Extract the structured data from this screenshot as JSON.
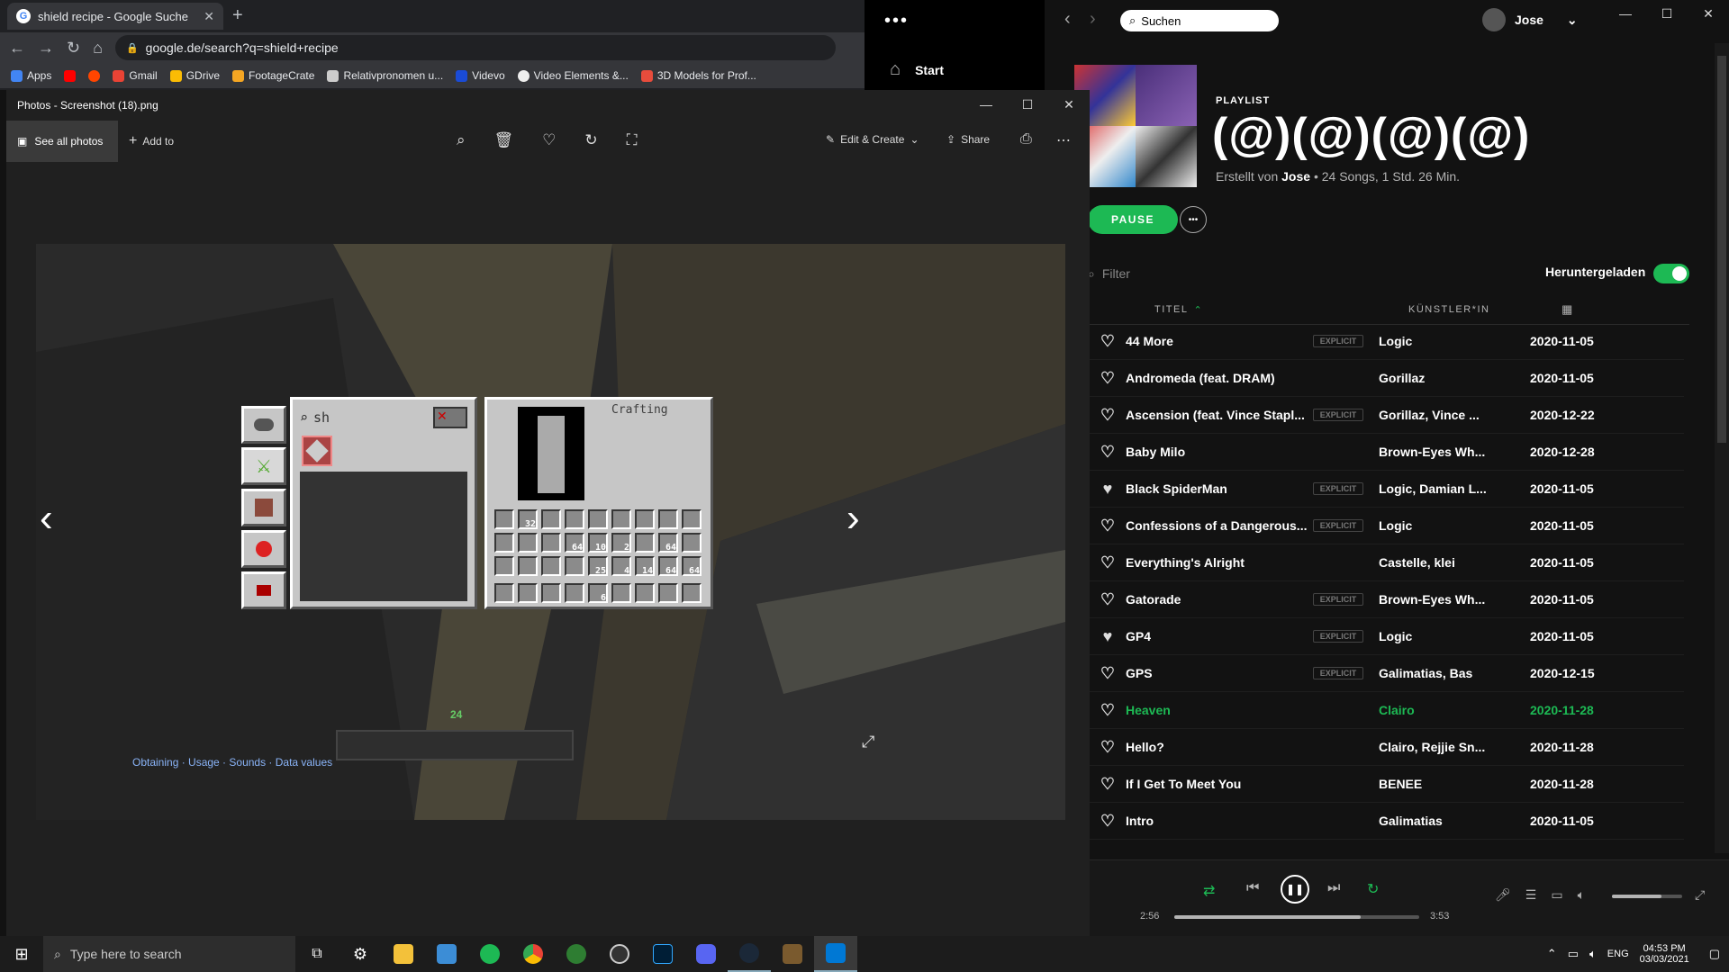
{
  "chrome": {
    "tab_title": "shield recipe - Google Suche",
    "url": "google.de/search?q=shield+recipe",
    "bookmarks": [
      "Apps",
      "",
      "",
      "Gmail",
      "GDrive",
      "FootageCrate",
      "Relativpronomen u...",
      "Videvo",
      "Video Elements &...",
      "3D Models for Prof..."
    ]
  },
  "photos": {
    "title": "Photos - Screenshot (18).png",
    "see_all": "See all photos",
    "add_to": "Add to",
    "edit_create": "Edit & Create",
    "share": "Share",
    "bottom_links": "Obtaining · Usage · Sounds · Data values"
  },
  "minecraft": {
    "search_text": "sh",
    "crafting_label": "Crafting",
    "stack_counts": [
      "32",
      "64",
      "10",
      "2",
      "64",
      "25",
      "4",
      "14",
      "64",
      "64",
      "6"
    ],
    "xp_level": "24"
  },
  "spotify": {
    "search_placeholder": "Suchen",
    "user": "Jose",
    "sidebar_start": "Start",
    "type_label": "PLAYLIST",
    "playlist_title": "(@)(@)(@)(@)",
    "created_by_prefix": "Erstellt von",
    "owner": "Jose",
    "meta": " • 24 Songs, 1 Std. 26 Min.",
    "pause": "PAUSE",
    "filter_placeholder": "Filter",
    "downloaded_label": "Heruntergeladen",
    "col_title": "TITEL",
    "col_artist": "KÜNSTLER*IN",
    "explicit": "EXPLICIT",
    "tracks": [
      {
        "title": "44 More",
        "artist": "Logic",
        "date": "2020-11-05",
        "explicit": true,
        "liked": false
      },
      {
        "title": "Andromeda (feat. DRAM)",
        "artist": "Gorillaz",
        "date": "2020-11-05",
        "explicit": false,
        "liked": false
      },
      {
        "title": "Ascension (feat. Vince Stapl...",
        "artist": "Gorillaz, Vince ...",
        "date": "2020-12-22",
        "explicit": true,
        "liked": false
      },
      {
        "title": "Baby Milo",
        "artist": "Brown-Eyes Wh...",
        "date": "2020-12-28",
        "explicit": false,
        "liked": false
      },
      {
        "title": "Black SpiderMan",
        "artist": "Logic, Damian L...",
        "date": "2020-11-05",
        "explicit": true,
        "liked": true
      },
      {
        "title": "Confessions of a Dangerous...",
        "artist": "Logic",
        "date": "2020-11-05",
        "explicit": true,
        "liked": false
      },
      {
        "title": "Everything's Alright",
        "artist": "Castelle, klei",
        "date": "2020-11-05",
        "explicit": false,
        "liked": false
      },
      {
        "title": "Gatorade",
        "artist": "Brown-Eyes Wh...",
        "date": "2020-11-05",
        "explicit": true,
        "liked": false
      },
      {
        "title": "GP4",
        "artist": "Logic",
        "date": "2020-11-05",
        "explicit": true,
        "liked": true
      },
      {
        "title": "GPS",
        "artist": "Galimatias, Bas",
        "date": "2020-12-15",
        "explicit": true,
        "liked": false
      },
      {
        "title": "Heaven",
        "artist": "Clairo",
        "date": "2020-11-28",
        "explicit": false,
        "liked": false,
        "playing": true
      },
      {
        "title": "Hello?",
        "artist": "Clairo, Rejjie Sn...",
        "date": "2020-11-28",
        "explicit": false,
        "liked": false
      },
      {
        "title": "If I Get To Meet You",
        "artist": "BENEE",
        "date": "2020-11-28",
        "explicit": false,
        "liked": false
      },
      {
        "title": "Intro",
        "artist": "Galimatias",
        "date": "2020-11-05",
        "explicit": false,
        "liked": false
      }
    ],
    "player": {
      "elapsed": "2:56",
      "total": "3:53",
      "progress": 0.76,
      "volume": 0.7
    }
  },
  "taskbar": {
    "search_placeholder": "Type here to search",
    "lang": "ENG",
    "time": "04:53 PM",
    "date": "03/03/2021"
  }
}
